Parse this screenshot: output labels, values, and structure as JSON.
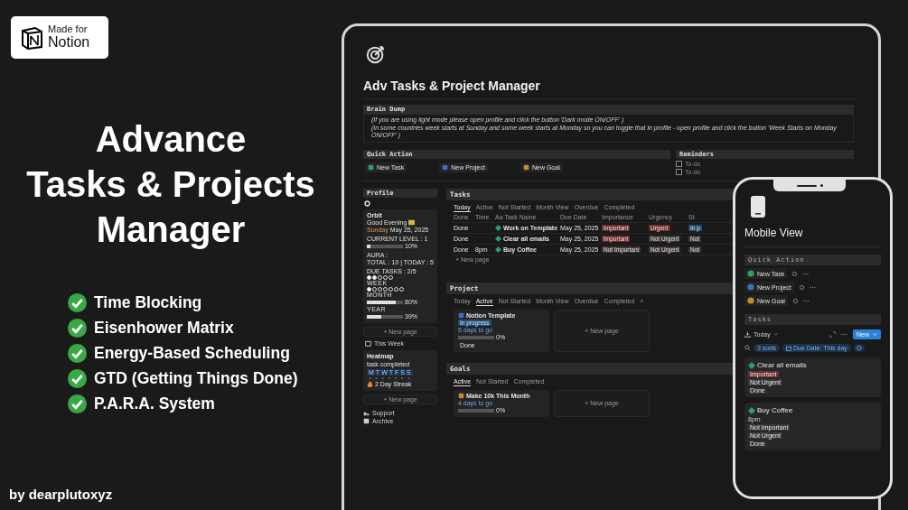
{
  "badge": {
    "caption": "Made for",
    "title": "Notion"
  },
  "headline": [
    "Advance",
    "Tasks & Projects",
    "Manager"
  ],
  "features": [
    {
      "label": "Time Blocking",
      "checked": true
    },
    {
      "label": "Eisenhower Matrix",
      "checked": true
    },
    {
      "label": "Energy-Based Scheduling",
      "checked": true
    },
    {
      "label": "GTD (Getting Things Done)",
      "checked": true
    },
    {
      "label": "P.A.R.A. System",
      "checked": true
    }
  ],
  "credit": "by dearplutoxyz",
  "app": {
    "title": "Adv Tasks & Project Manager",
    "brain_dump": {
      "heading": "Brain Dump",
      "lines": [
        "(If you are using light mode please open profile and click the button 'Dark mode ON/OFF' )",
        "(In some countries week starts at Sunday and some week starts at Monday so you can toggle that in profile - open profile and click the button 'Week Starts on Monday ON/OFF' )"
      ]
    },
    "quick_action": {
      "heading": "Quick Action",
      "buttons": [
        {
          "label": "New Task",
          "color": "#2e9e6a"
        },
        {
          "label": "New Project",
          "color": "#3b6fbf"
        },
        {
          "label": "New Goal",
          "color": "#c98a2e"
        }
      ]
    },
    "reminders": {
      "heading": "Reminders",
      "items": [
        {
          "label": "To-do",
          "checked": false
        },
        {
          "label": "To-do",
          "checked": false
        }
      ]
    },
    "profile": {
      "heading": "Profile",
      "orbit": {
        "title": "Orbit",
        "greeting": "Good Evening",
        "weekday": "Sunday",
        "date": "May 25, 2025",
        "level_label": "CURRENT LEVEL : 1",
        "level": {
          "level": 0.1,
          "reading": "10%"
        },
        "aura_label": "AURA :",
        "aura_totals": "TOTAL : 10 | TODAY : 5",
        "due_label": "DUE TASKS : 2/5",
        "due_dots": [
          {
            "filled": true
          },
          {
            "filled": true
          },
          {
            "filled": false
          },
          {
            "filled": false
          },
          {
            "filled": false
          }
        ],
        "week_label": "WEEK",
        "week_dots": [
          {
            "filled": true
          },
          {
            "filled": false
          },
          {
            "filled": false
          },
          {
            "filled": false
          },
          {
            "filled": false
          },
          {
            "filled": false
          },
          {
            "filled": false
          }
        ],
        "month_label": "MONTH",
        "month": {
          "level": 0.8,
          "reading": "80%"
        },
        "year_label": "YEAR",
        "year": {
          "level": 0.39,
          "reading": "39%"
        }
      },
      "new_page": "+ New page",
      "view": "This Week",
      "heatmap": {
        "title": "Heatmap",
        "caption": "task completed",
        "days": [
          "M",
          "T",
          "W",
          "T",
          "F",
          "S",
          "S"
        ],
        "streak": "2 Day Streak"
      },
      "new_page_2": "+ New page",
      "links": [
        {
          "label": "Support",
          "kind": "support"
        },
        {
          "label": "Archive",
          "kind": "archive"
        }
      ]
    },
    "tasks": {
      "heading": "Tasks",
      "tabs": [
        {
          "label": "Today",
          "selected": true
        },
        {
          "label": "Active",
          "selected": false
        },
        {
          "label": "Not Started",
          "selected": false
        },
        {
          "label": "Month View",
          "selected": false
        },
        {
          "label": "Overdue",
          "selected": false
        },
        {
          "label": "Completed",
          "selected": false
        }
      ],
      "columns": [
        {
          "label": "Done"
        },
        {
          "label": "Time"
        },
        {
          "prefix": "Aa",
          "label": "Task Name"
        },
        {
          "label": "Due Date"
        },
        {
          "label": "Importance"
        },
        {
          "label": "Urgency"
        },
        {
          "label": "St"
        }
      ],
      "rows": [
        {
          "done": "Done",
          "name": "Work on Template",
          "due": "May 25, 2025",
          "importance": {
            "label": "Important",
            "color": "#6e2c2c"
          },
          "urgency": {
            "label": "Urgent",
            "color": "#6e2c2c"
          },
          "status": {
            "label": "In p",
            "color": "#1e4e78"
          }
        },
        {
          "done": "Done",
          "name": "Clear all emails",
          "due": "May 25, 2025",
          "importance": {
            "label": "Important",
            "color": "#6e2c2c"
          },
          "urgency": {
            "label": "Not Urgent",
            "color": "#383838"
          },
          "status": {
            "label": "Not",
            "color": "#383838"
          }
        },
        {
          "done": "Done",
          "time": "8pm",
          "name": "Buy Coffee",
          "due": "May 25, 2025",
          "importance": {
            "label": "Not Important",
            "color": "#383838"
          },
          "urgency": {
            "label": "Not Urgent",
            "color": "#383838"
          },
          "status": {
            "label": "Not",
            "color": "#383838"
          }
        }
      ],
      "new_page": "+ New page"
    },
    "project": {
      "heading": "Project",
      "tabs": [
        {
          "label": "Today",
          "selected": false
        },
        {
          "label": "Active",
          "selected": true
        },
        {
          "label": "Not Started",
          "selected": false
        },
        {
          "label": "Month View",
          "selected": false
        },
        {
          "label": "Overdue",
          "selected": false
        },
        {
          "label": "Completed",
          "selected": false
        }
      ],
      "add": "+",
      "card": {
        "name": "Notion Template",
        "color": "#3b6fbf",
        "tag": {
          "label": "In progress",
          "color": "#1e4e78"
        },
        "countdown": "5 days to go",
        "progress": {
          "level": 0,
          "reading": "0%"
        },
        "status": "Done"
      },
      "new_page": "+ New page"
    },
    "goals": {
      "heading": "Goals",
      "tabs": [
        {
          "label": "Active",
          "selected": true
        },
        {
          "label": "Not Started",
          "selected": false
        },
        {
          "label": "Completed",
          "selected": false
        }
      ],
      "card": {
        "name": "Make 10k This Month",
        "color": "#c98a2e",
        "countdown": "4 days to go",
        "progress": {
          "level": 0,
          "reading": "0%"
        }
      },
      "new_page": "+ New page"
    }
  },
  "mobile": {
    "title": "Mobile View",
    "quick_heading": "Quick Action",
    "buttons": [
      {
        "label": "New Task",
        "color": "#2e9e6a"
      },
      {
        "label": "New Project",
        "color": "#3b6fbf"
      },
      {
        "label": "New Goal",
        "color": "#c98a2e"
      }
    ],
    "tasks_heading": "Tasks",
    "view": "Today",
    "new_button": "New",
    "sort_chip": "3 sorts",
    "filter_chip": "Due Date: This day",
    "cards": [
      {
        "name": "Clear all emails",
        "tags": [
          {
            "label": "Important",
            "color": "#6e2c2c"
          },
          {
            "label": "Not Urgent",
            "color": "#383838"
          },
          {
            "label": "Done",
            "color": "#2e2e2e"
          }
        ]
      },
      {
        "name": "Buy Coffee",
        "time": "8pm",
        "tags": [
          {
            "label": "Not Important",
            "color": "#383838"
          },
          {
            "label": "Not Urgent",
            "color": "#383838"
          },
          {
            "label": "Done",
            "color": "#2e2e2e"
          }
        ]
      }
    ]
  }
}
